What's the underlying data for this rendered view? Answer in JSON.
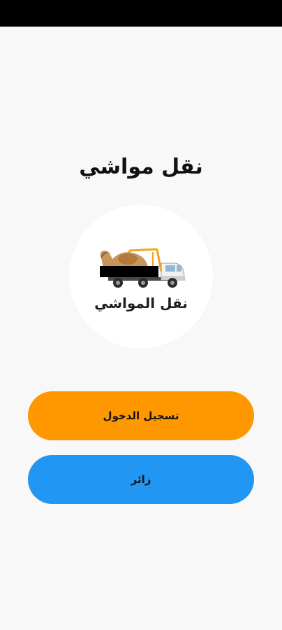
{
  "app": {
    "title": "نقل مواشي"
  },
  "logo": {
    "caption": "نقل المواشي",
    "icon": "livestock-truck-logo"
  },
  "buttons": {
    "login_label": "تسجيل الدخول",
    "guest_label": "زائر"
  },
  "colors": {
    "login_button": "#ff9800",
    "guest_button": "#2196f3",
    "background": "#f8f8f8",
    "status_bar": "#000000"
  }
}
